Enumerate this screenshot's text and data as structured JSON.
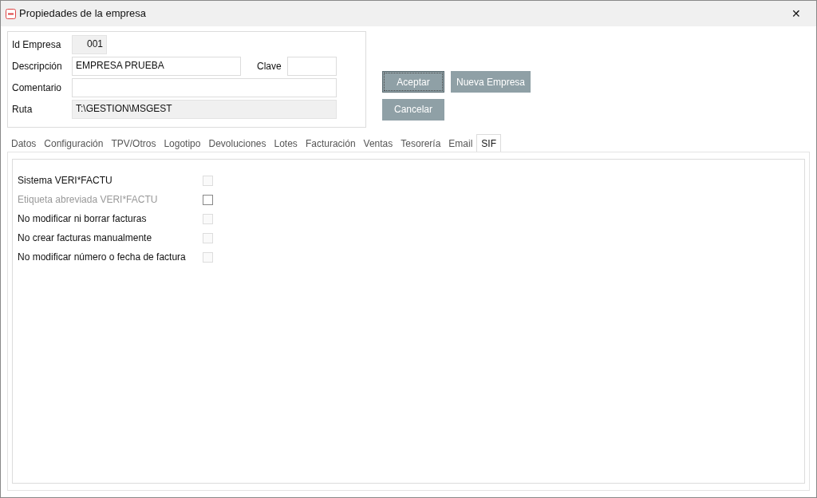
{
  "window": {
    "title": "Propiedades de la empresa",
    "close": "✕"
  },
  "fields": [
    {
      "label": "Id Empresa",
      "value": "001",
      "kind": "id"
    },
    {
      "label": "Descripción",
      "value": "EMPRESA PRUEBA",
      "kind": "text"
    },
    {
      "label": "Clave",
      "kind": "key"
    },
    {
      "label": "Comentario",
      "kind": "wide"
    },
    {
      "label": "Ruta",
      "value": "T:\\GESTION\\MSGEST",
      "kind": "readonly"
    }
  ],
  "buttons": [
    {
      "label": "Aceptar",
      "focused": true
    },
    {
      "label": "Nueva Empresa",
      "focused": false
    },
    {
      "label": "Cancelar",
      "focused": false
    }
  ],
  "tabs": [
    {
      "label": "Datos",
      "selected": false
    },
    {
      "label": "Configuración",
      "selected": false
    },
    {
      "label": "TPV/Otros",
      "selected": false
    },
    {
      "label": "Logotipo",
      "selected": false
    },
    {
      "label": "Devoluciones",
      "selected": false
    },
    {
      "label": "Lotes",
      "selected": false
    },
    {
      "label": "Facturación",
      "selected": false
    },
    {
      "label": "Ventas",
      "selected": false
    },
    {
      "label": "Tesorería",
      "selected": false
    },
    {
      "label": "Email",
      "selected": false
    },
    {
      "label": "SIF",
      "selected": true
    }
  ],
  "options": [
    {
      "label": "Sistema VERI*FACTU",
      "checked": false,
      "label_dimmed": false,
      "disabled": true
    },
    {
      "label": "Etiqueta abreviada VERI*FACTU",
      "checked": false,
      "label_dimmed": true,
      "disabled": false
    },
    {
      "label": "No modificar ni borrar facturas",
      "checked": false,
      "label_dimmed": false,
      "disabled": true
    },
    {
      "label": "No crear facturas manualmente",
      "checked": false,
      "label_dimmed": false,
      "disabled": true
    },
    {
      "label": "No modificar número o fecha de factura",
      "checked": false,
      "label_dimmed": false,
      "disabled": true
    }
  ]
}
